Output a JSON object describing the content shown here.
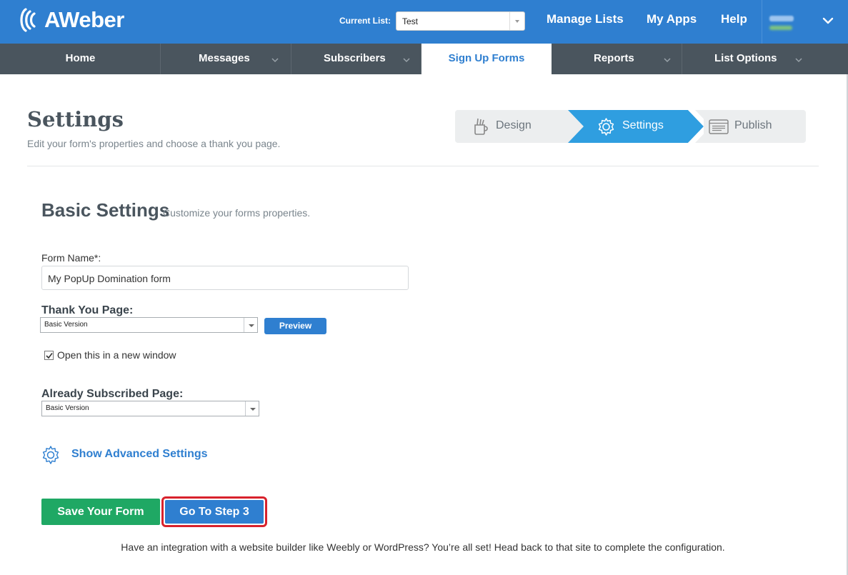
{
  "header": {
    "brand": "AWeber",
    "current_list_label": "Current List:",
    "current_list_value": "Test",
    "links": [
      "Manage Lists",
      "My Apps",
      "Help"
    ]
  },
  "nav": {
    "items": [
      {
        "label": "Home",
        "has_menu": false
      },
      {
        "label": "Messages",
        "has_menu": true
      },
      {
        "label": "Subscribers",
        "has_menu": true
      },
      {
        "label": "Sign Up Forms",
        "has_menu": false,
        "active": true
      },
      {
        "label": "Reports",
        "has_menu": true
      },
      {
        "label": "List Options",
        "has_menu": true
      }
    ]
  },
  "page": {
    "title": "Settings",
    "subtitle": "Edit your form's properties and choose a thank you page."
  },
  "steps": {
    "items": [
      "Design",
      "Settings",
      "Publish"
    ],
    "active": "Settings"
  },
  "basic_settings": {
    "title": "Basic Settings",
    "subtitle": "Customize your forms properties.",
    "form_name_label": "Form Name*:",
    "form_name_value": "My PopUp Domination form",
    "thank_you_label": "Thank You Page:",
    "thank_you_value": "Basic Version",
    "preview_label": "Preview",
    "new_window_label": "Open this in a new window",
    "new_window_checked": true,
    "already_subscribed_label": "Already Subscribed Page:",
    "already_subscribed_value": "Basic Version",
    "advanced_link": "Show Advanced Settings"
  },
  "actions": {
    "save_label": "Save Your Form",
    "next_label": "Go To Step 3"
  },
  "footer": {
    "note": "Have an integration with a website builder like Weebly or WordPress? You’re all set! Head back to that site to complete the configuration."
  },
  "colors": {
    "header_blue": "#2f7fd0",
    "nav_gray": "#4a555e",
    "step_active": "#2f9ee0",
    "save_green": "#1fa864",
    "highlight_red": "#d8222c"
  }
}
